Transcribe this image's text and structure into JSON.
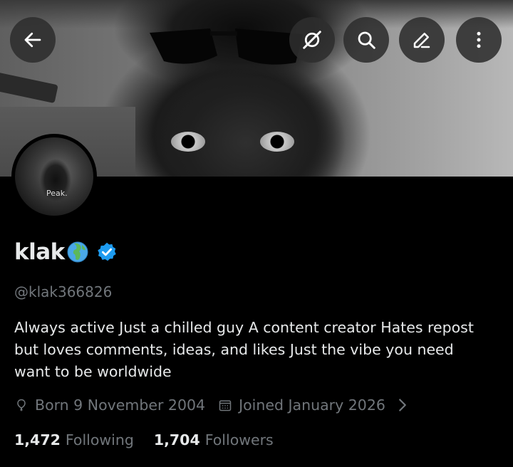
{
  "header": {
    "buttons": [
      {
        "icon": "back-arrow-icon"
      },
      {
        "icon": "grok-icon"
      },
      {
        "icon": "search-icon"
      },
      {
        "icon": "edit-icon"
      },
      {
        "icon": "more-vertical-icon"
      }
    ]
  },
  "avatar": {
    "caption": "Peak."
  },
  "profile": {
    "display_name": "klak",
    "name_emoji": "globe-africa-europe-icon",
    "verified_color": "#1d9bf0",
    "handle": "@klak366826",
    "bio": "Always active  Just a chilled guy  A content creator Hates repost\nbut loves comments, ideas, and likes  Just the vibe you need\nwant to be worldwide",
    "birth": "Born 9 November 2004",
    "joined": "Joined January 2026",
    "following_count": "1,472",
    "following_label": "Following",
    "followers_count": "1,704",
    "followers_label": "Followers"
  },
  "colors": {
    "background": "#000000",
    "primary_text": "#e7e9ea",
    "secondary_text": "#71767b",
    "accent": "#1d9bf0"
  }
}
